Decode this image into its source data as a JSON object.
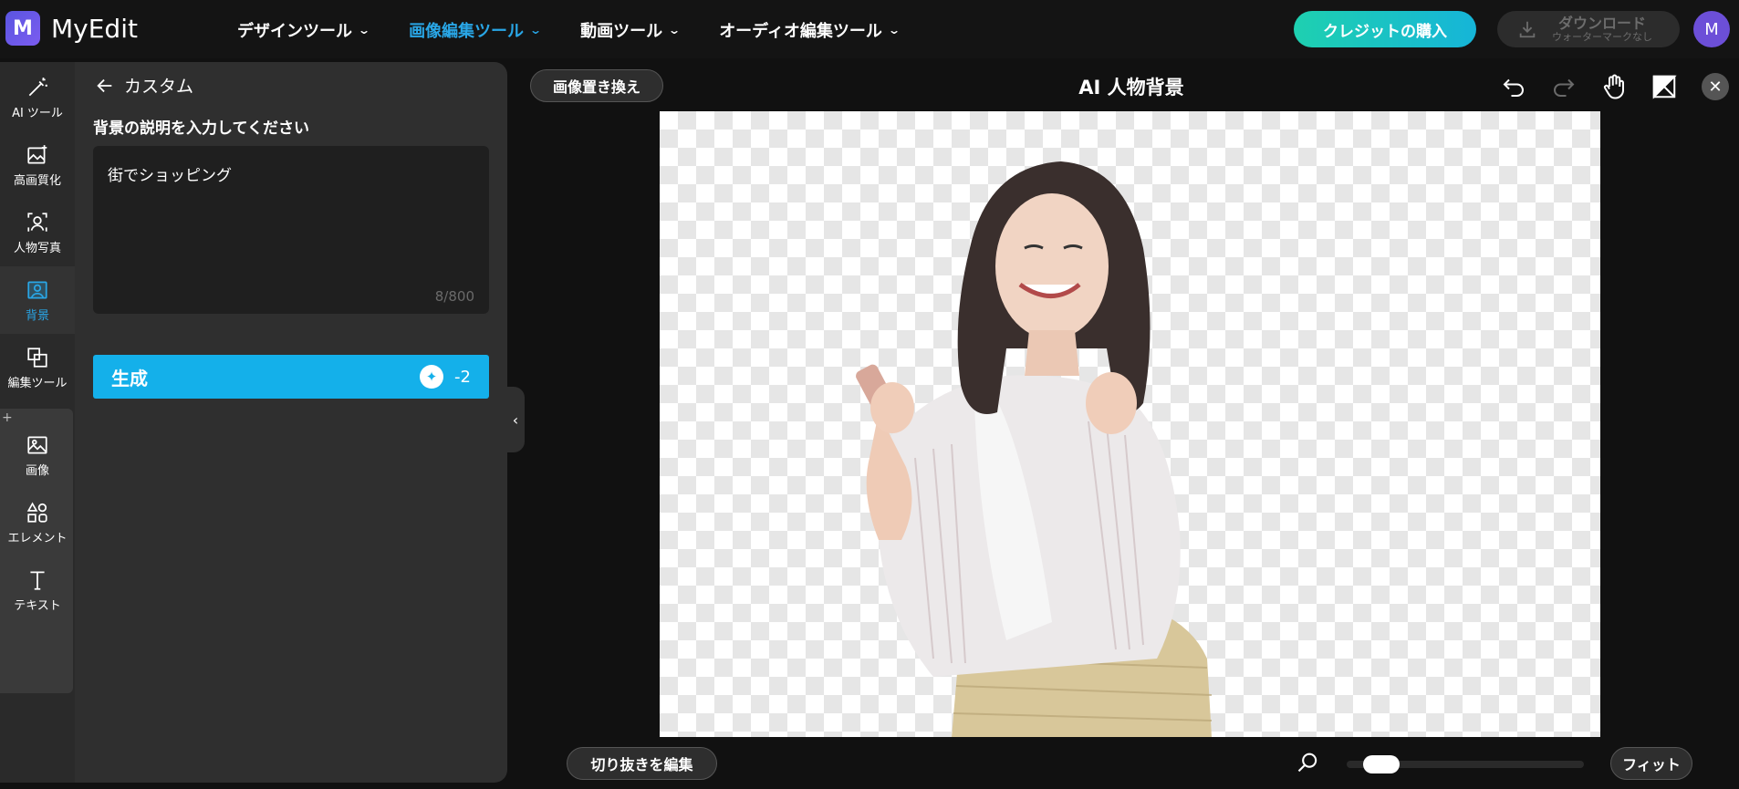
{
  "app": {
    "logo_letter": "M",
    "name": "MyEdit"
  },
  "nav": {
    "items": [
      {
        "label": "デザインツール"
      },
      {
        "label": "画像編集ツール"
      },
      {
        "label": "動画ツール"
      },
      {
        "label": "オーディオ編集ツール"
      }
    ],
    "active_index": 1
  },
  "header": {
    "credit_button": "クレジットの購入",
    "download_main": "ダウンロード",
    "download_sub": "ウォーターマークなし",
    "avatar_initial": "M"
  },
  "sidebar": {
    "items": [
      {
        "label": "AI ツール",
        "icon": "magic-wand-icon"
      },
      {
        "label": "高画質化",
        "icon": "enhance-image-icon"
      },
      {
        "label": "人物写真",
        "icon": "portrait-icon"
      },
      {
        "label": "背景",
        "icon": "background-icon",
        "active": true
      },
      {
        "label": "編集ツール",
        "icon": "crop-icon"
      },
      {
        "label": "画像",
        "icon": "image-icon"
      },
      {
        "label": "エレメント",
        "icon": "shapes-icon"
      },
      {
        "label": "テキスト",
        "icon": "text-icon"
      }
    ],
    "plus": "+"
  },
  "panel": {
    "back_label": "カスタム",
    "prompt_label": "背景の説明を入力してください",
    "prompt_value": "街でショッピング",
    "char_count": "8/800",
    "generate_label": "生成",
    "generate_cost": "-2"
  },
  "canvas": {
    "replace_button": "画像置き換え",
    "title": "AI 人物背景",
    "edit_cutout_button": "切り抜きを編集",
    "fit_button": "フィット",
    "zoom_level": 0.08
  },
  "colors": {
    "accent": "#29a6e6",
    "generate": "#14b0ea",
    "credit_start": "#1ed0b0",
    "credit_end": "#16b5d8"
  }
}
